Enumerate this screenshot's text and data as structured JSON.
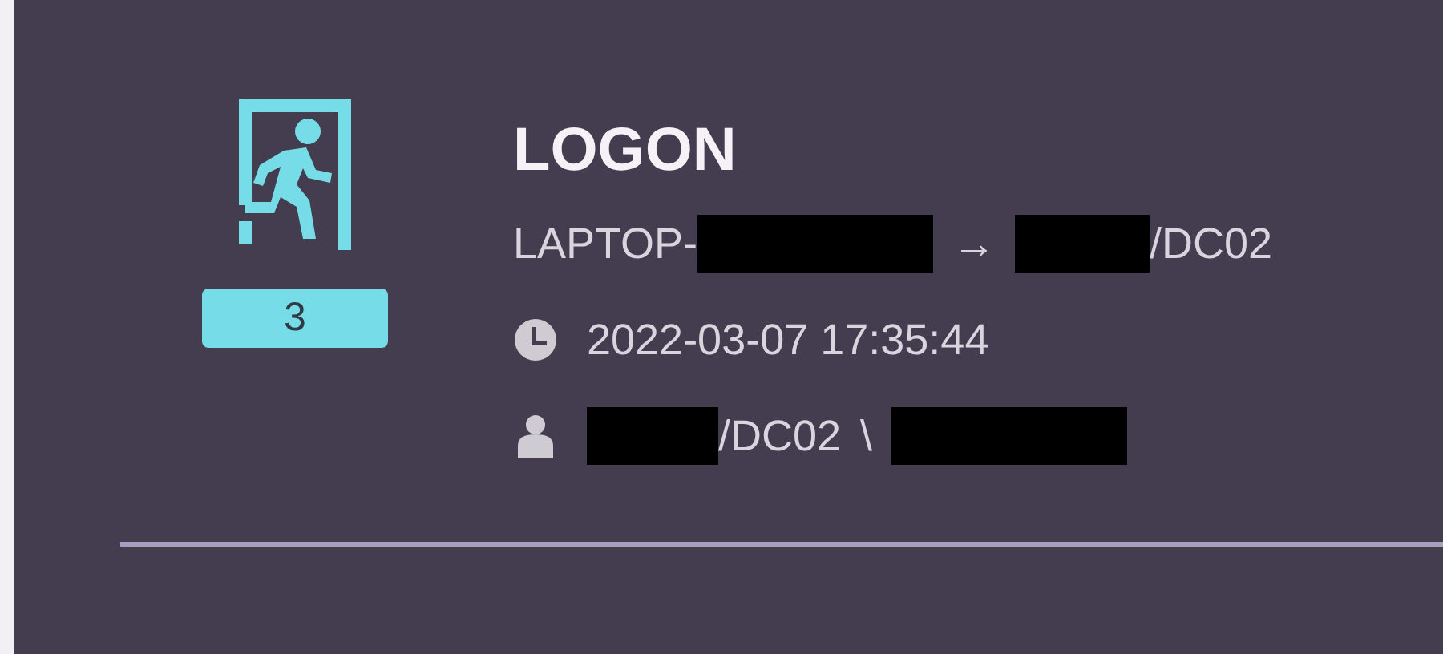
{
  "event": {
    "title": "LOGON",
    "count": "3",
    "route": {
      "source": "LAPTOP-",
      "arrow": "→",
      "target": "/DC02"
    },
    "timestamp": "2022-03-07 17:35:44",
    "account": {
      "domain": "/DC02",
      "separator": "\\"
    }
  }
}
